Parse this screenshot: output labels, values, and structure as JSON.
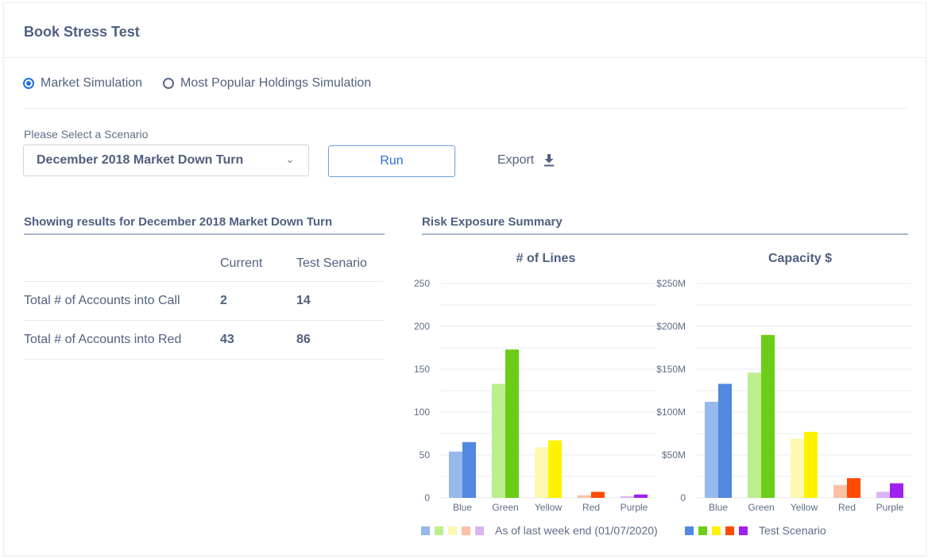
{
  "header": {
    "title": "Book Stress Test"
  },
  "simulation_options": [
    {
      "label": "Market Simulation",
      "selected": true
    },
    {
      "label": "Most Popular Holdings Simulation",
      "selected": false
    }
  ],
  "scenario": {
    "label": "Please Select a Scenario",
    "selected": "December 2018 Market Down Turn",
    "chevron_icon": "chevron-down-icon"
  },
  "actions": {
    "run_label": "Run",
    "export_label": "Export",
    "export_icon": "download-icon"
  },
  "results": {
    "title": "Showing results for December 2018 Market Down Turn",
    "columns": [
      "",
      "Current",
      "Test Senario"
    ],
    "rows": [
      {
        "label": "Total # of Accounts into Call",
        "current": "2",
        "test": "14"
      },
      {
        "label": "Total # of Accounts into Red",
        "current": "43",
        "test": "86"
      }
    ]
  },
  "risk": {
    "title": "Risk Exposure Summary"
  },
  "colors": {
    "last_week": [
      "#97b8ec",
      "#bdef8e",
      "#fdf8b0",
      "#fbc0a6",
      "#dcb4f7"
    ],
    "test": [
      "#4f89e0",
      "#6ccd16",
      "#fff200",
      "#ff4a00",
      "#a020f0"
    ]
  },
  "chart_data": [
    {
      "type": "bar",
      "title": "# of Lines",
      "categories": [
        "Blue",
        "Green",
        "Yellow",
        "Red",
        "Purple"
      ],
      "yticks": [
        "0",
        "50",
        "100",
        "150",
        "200",
        "250"
      ],
      "ylim": [
        0,
        250
      ],
      "grid": true,
      "series": [
        {
          "name": "As of last week end (01/07/2020)",
          "values": [
            54,
            133,
            59,
            3,
            2
          ]
        },
        {
          "name": "Test Scenario",
          "values": [
            65,
            173,
            67,
            7,
            4
          ]
        }
      ]
    },
    {
      "type": "bar",
      "title": "Capacity $",
      "categories": [
        "Blue",
        "Green",
        "Yellow",
        "Red",
        "Purple"
      ],
      "yticks": [
        "0",
        "$50M",
        "$100M",
        "$150M",
        "$200M",
        "$250M"
      ],
      "ylim": [
        0,
        250
      ],
      "unit": "$M",
      "grid": true,
      "series": [
        {
          "name": "As of last week end (01/07/2020)",
          "values": [
            112,
            146,
            69,
            15,
            7
          ]
        },
        {
          "name": "Test Scenario",
          "values": [
            133,
            190,
            77,
            23,
            17
          ]
        }
      ]
    }
  ],
  "legend": {
    "last_week_label": "As of last week end (01/07/2020)",
    "test_label": "Test Scenario"
  }
}
